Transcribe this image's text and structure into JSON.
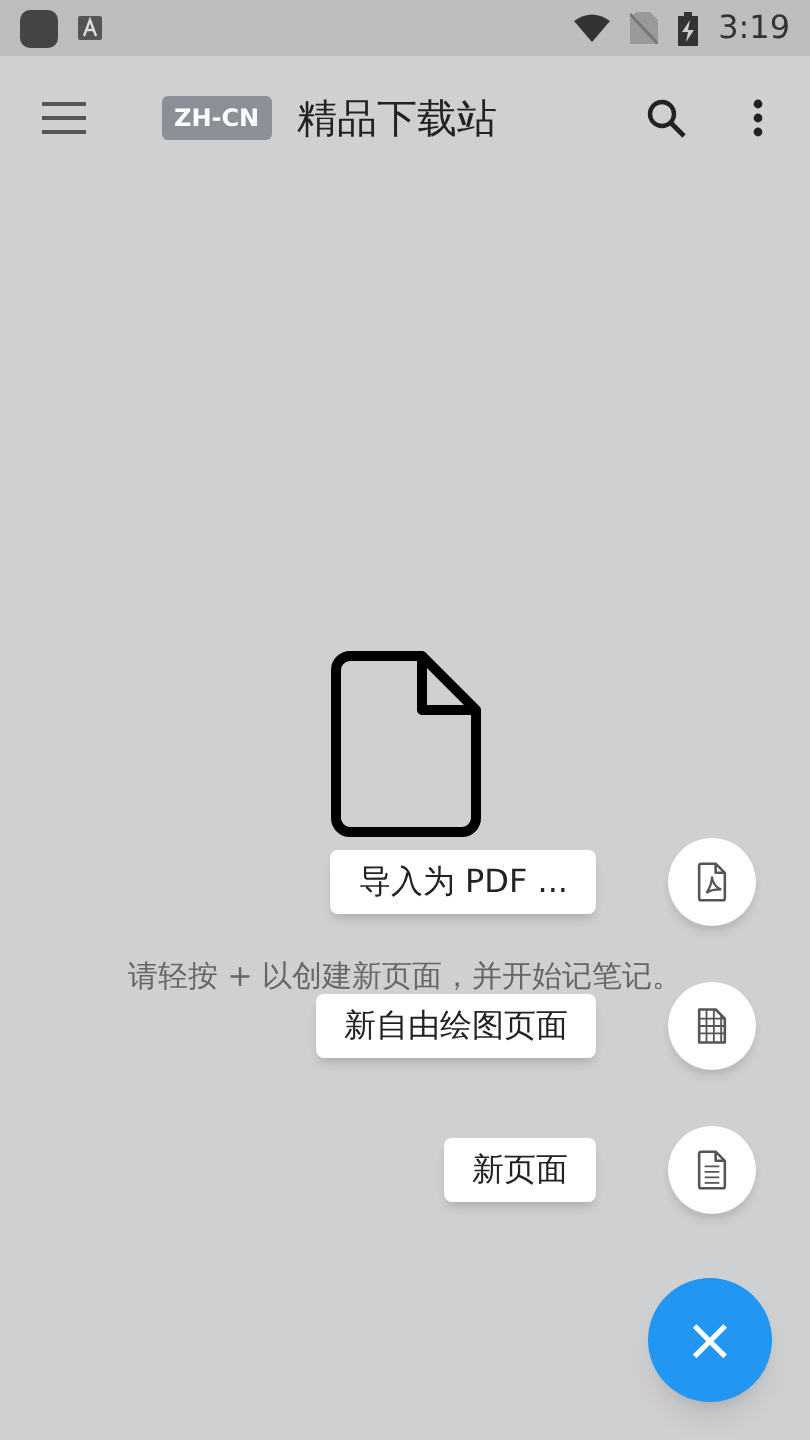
{
  "status_bar": {
    "time": "3:19"
  },
  "app_bar": {
    "language_badge": "ZH-CN",
    "title": "精品下载站"
  },
  "empty_state": {
    "hint": "请轻按 + 以创建新页面，并开始记笔记。"
  },
  "speed_dial": {
    "expanded": true,
    "fab_label": "×",
    "actions": [
      {
        "kind": "pdf",
        "label": "导入为 PDF ..."
      },
      {
        "kind": "drawing",
        "label": "新自由绘图页面"
      },
      {
        "kind": "page",
        "label": "新页面"
      }
    ]
  }
}
